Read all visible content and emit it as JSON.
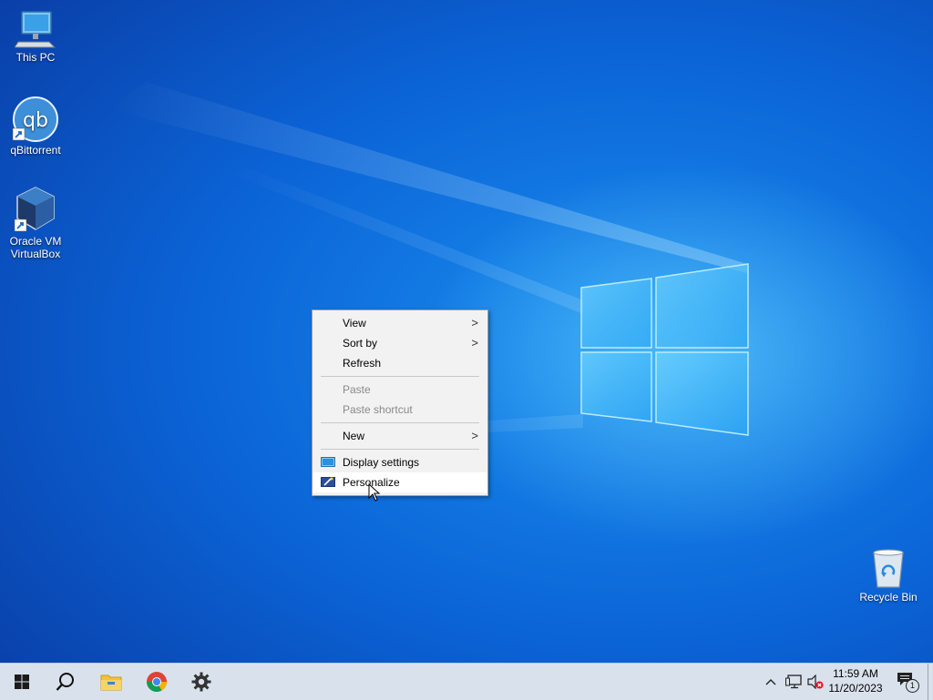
{
  "desktop_icons": [
    {
      "name": "this-pc",
      "label": "This PC",
      "icon": "computer-icon"
    },
    {
      "name": "qbittorrent",
      "label": "qBittorrent",
      "icon": "qbittorrent-icon",
      "logo_text": "qb"
    },
    {
      "name": "virtualbox",
      "label": "Oracle VM VirtualBox",
      "icon": "virtualbox-icon"
    },
    {
      "name": "recycle-bin",
      "label": "Recycle Bin",
      "icon": "recycle-bin-icon"
    }
  ],
  "context_menu": {
    "view": "View",
    "sort_by": "Sort by",
    "refresh": "Refresh",
    "paste": "Paste",
    "paste_shortcut": "Paste shortcut",
    "new": "New",
    "display_settings": "Display settings",
    "personalize": "Personalize",
    "submenu_arrow": ">"
  },
  "taskbar": {
    "apps": [
      "start-icon",
      "search-icon",
      "file-explorer-icon",
      "chrome-icon",
      "settings-icon"
    ],
    "tray": [
      "chevron-up-icon",
      "network-icon",
      "volume-muted-icon"
    ],
    "time": "11:59 AM",
    "date": "11/20/2023",
    "notification_count": "1"
  },
  "colors": {
    "accent": "#0b63d6",
    "taskbar": "#d9e2ec",
    "menu_bg": "#f2f2f2"
  }
}
